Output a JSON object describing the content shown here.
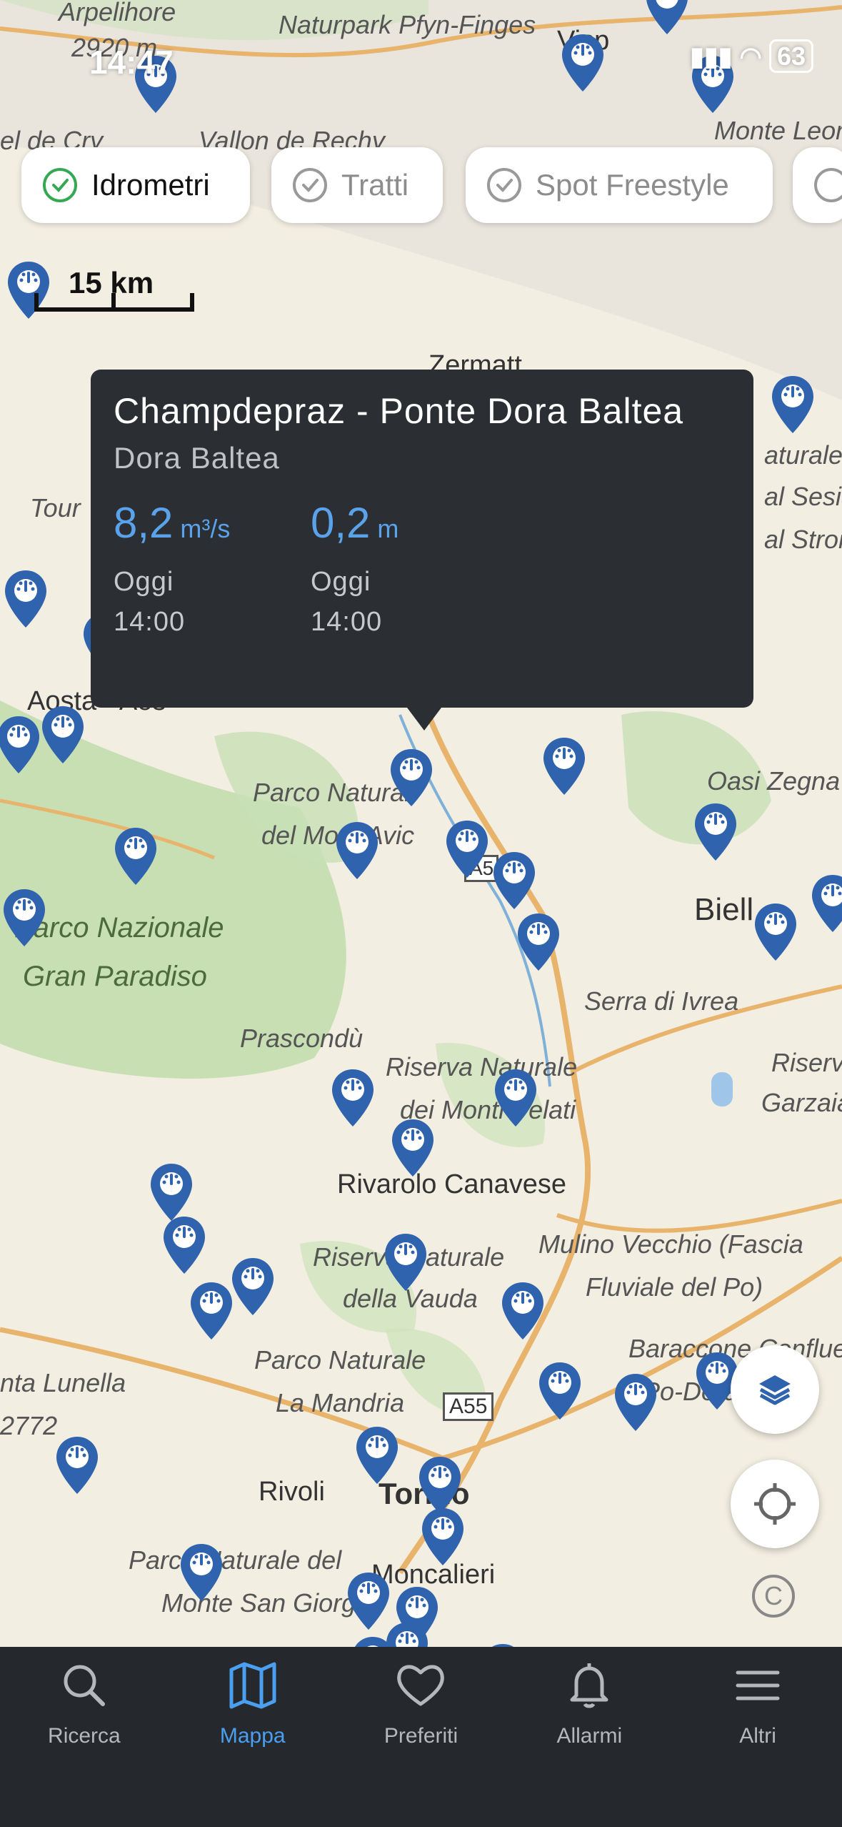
{
  "status_bar": {
    "time": "14:47",
    "battery": "63"
  },
  "filters": [
    {
      "label": "Idrometri",
      "active": true
    },
    {
      "label": "Tratti",
      "active": false
    },
    {
      "label": "Spot Freestyle",
      "active": false
    }
  ],
  "scale": {
    "label": "15 km"
  },
  "map_labels": {
    "arpelihore": "Arpelihore",
    "pfyn": "Naturpark Pfyn-Finges",
    "visp": "Visp",
    "monte_leone": "Monte Leon",
    "vallon": "Vallon de Rechy",
    "cry": "el de Cry",
    "z2920": "2920 m",
    "zermatt": "Zermatt",
    "tour": "Tour",
    "naturale": "aturale",
    "sesia": "al Sesia e",
    "strona": "al Strona",
    "aosta": "Aosta - Aos",
    "oasi_zegna": "Oasi Zegna",
    "parco_mont_avic1": "Parco Natural",
    "parco_mont_avic2": "del Mont Avic",
    "biella": "Biell",
    "gran_paradiso1": "Parco Nazionale",
    "gran_paradiso2": "Gran Paradiso",
    "serra": "Serra di Ivrea",
    "prascondu": "Prascondù",
    "riserva_pelati1": "Riserva Naturale",
    "riserva_pelati2": "dei Monti Pelati",
    "riserva_r": "Riserva n",
    "garzaia": "Garzaia",
    "rivarolo": "Rivarolo Canavese",
    "mulino1": "Mulino Vecchio (Fascia",
    "mulino2": "Fluviale del Po)",
    "vauda1": "Riserva Naturale",
    "vauda2": "della Vauda",
    "lunella": "nta Lunella",
    "z2772": "2772",
    "mandria1": "Parco Naturale",
    "mandria2": "La Mandria",
    "a55": "A55",
    "a5": "A5",
    "confluenza": "Baraccone Confluenz",
    "po_dora": "Po-Dora",
    "rivoli": "Rivoli",
    "torino": "Torino",
    "san_giorgio1": "Parco Naturale del",
    "san_giorgio2": "Monte San Giorgio",
    "moncalieri": "Moncalieri"
  },
  "popup": {
    "title": "Champdepraz - Ponte Dora Baltea",
    "river": "Dora Baltea",
    "metrics": [
      {
        "value": "8,2",
        "unit": "m³/s",
        "day": "Oggi",
        "time": "14:00"
      },
      {
        "value": "0,2",
        "unit": "m",
        "day": "Oggi",
        "time": "14:00"
      }
    ]
  },
  "copyright_symbol": "C",
  "tabs": [
    {
      "label": "Ricerca",
      "icon": "search-icon",
      "active": false
    },
    {
      "label": "Mappa",
      "icon": "map-icon",
      "active": true
    },
    {
      "label": "Preferiti",
      "icon": "heart-icon",
      "active": false
    },
    {
      "label": "Allarmi",
      "icon": "bell-icon",
      "active": false
    },
    {
      "label": "Altri",
      "icon": "menu-icon",
      "active": false
    }
  ],
  "colors": {
    "pin": "#2f63ad",
    "accent": "#4a9ff0",
    "popup_bg": "#2b2e33",
    "tabbar_bg": "#25282c"
  }
}
